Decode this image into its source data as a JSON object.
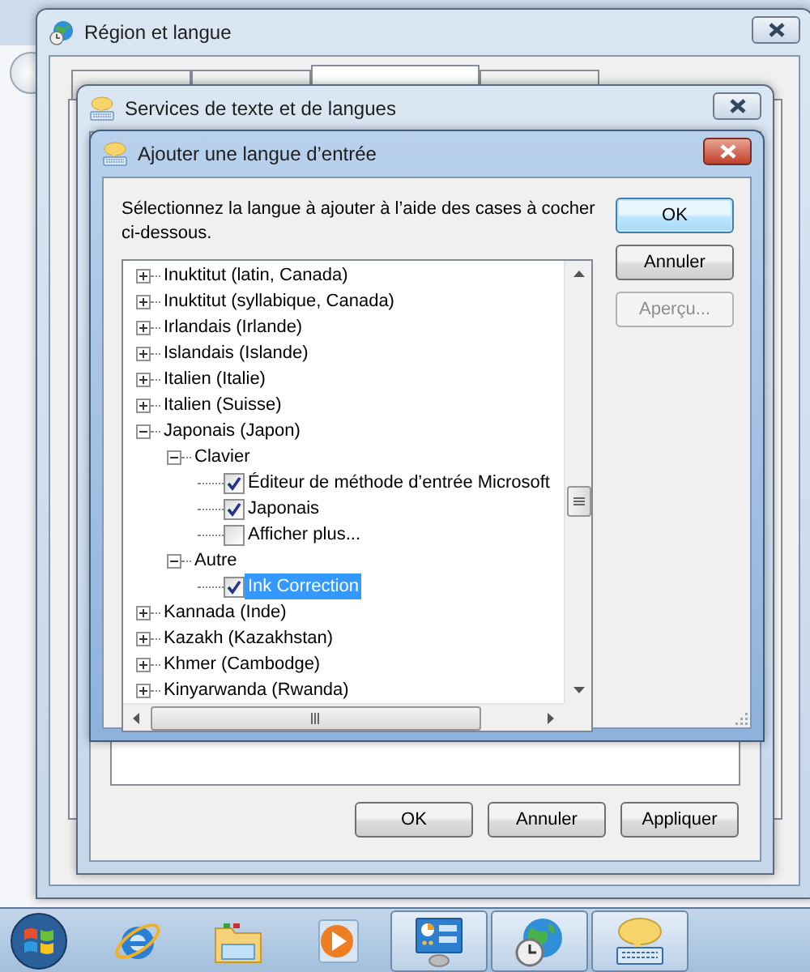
{
  "windows": {
    "region": {
      "title": "Région et langue",
      "tabs": [
        {
          "selected": false
        },
        {
          "selected": false
        },
        {
          "selected": true
        },
        {
          "selected": false
        }
      ]
    },
    "services": {
      "title": "Services de texte et de langues",
      "buttons": [
        {
          "label": "OK",
          "disabled": false
        },
        {
          "label": "Annuler",
          "disabled": false
        },
        {
          "label": "Appliquer",
          "disabled": false
        }
      ]
    },
    "add_language": {
      "title": "Ajouter une langue d’entrée",
      "instruction": "Sélectionnez la langue à ajouter à l’aide des cases à cocher ci-dessous.",
      "buttons": [
        {
          "label": "OK",
          "default": true,
          "disabled": false
        },
        {
          "label": "Annuler",
          "default": false,
          "disabled": false
        },
        {
          "label": "Aperçu...",
          "default": false,
          "disabled": true
        }
      ],
      "tree": [
        {
          "kind": "group",
          "label": "Inuktitut (latin, Canada)",
          "expanded": false,
          "selected": false
        },
        {
          "kind": "group",
          "label": "Inuktitut (syllabique, Canada)",
          "expanded": false,
          "selected": false
        },
        {
          "kind": "group",
          "label": "Irlandais (Irlande)",
          "expanded": false,
          "selected": false
        },
        {
          "kind": "group",
          "label": "Islandais (Islande)",
          "expanded": false,
          "selected": false
        },
        {
          "kind": "group",
          "label": "Italien (Italie)",
          "expanded": false,
          "selected": false
        },
        {
          "kind": "group",
          "label": "Italien (Suisse)",
          "expanded": false,
          "selected": false
        },
        {
          "kind": "group",
          "label": "Japonais (Japon)",
          "expanded": true,
          "selected": false,
          "children": [
            {
              "kind": "group",
              "label": "Clavier",
              "expanded": true,
              "selected": false,
              "children": [
                {
                  "kind": "option",
                  "label": "Éditeur de méthode d’entrée Microsoft",
                  "checked": true,
                  "selected": false
                },
                {
                  "kind": "option",
                  "label": "Japonais",
                  "checked": true,
                  "selected": false
                },
                {
                  "kind": "option",
                  "label": "Afficher plus...",
                  "checked": false,
                  "selected": false
                }
              ]
            },
            {
              "kind": "group",
              "label": "Autre",
              "expanded": true,
              "selected": false,
              "children": [
                {
                  "kind": "option",
                  "label": "Ink Correction",
                  "checked": true,
                  "selected": true
                }
              ]
            }
          ]
        },
        {
          "kind": "group",
          "label": "Kannada (Inde)",
          "expanded": false,
          "selected": false
        },
        {
          "kind": "group",
          "label": "Kazakh (Kazakhstan)",
          "expanded": false,
          "selected": false
        },
        {
          "kind": "group",
          "label": "Khmer (Cambodge)",
          "expanded": false,
          "selected": false
        },
        {
          "kind": "group",
          "label": "Kinyarwanda (Rwanda)",
          "expanded": false,
          "selected": false
        }
      ]
    }
  },
  "taskbar": {
    "items": [
      {
        "kind": "browser",
        "open": false
      },
      {
        "kind": "folder",
        "open": false
      },
      {
        "kind": "media",
        "open": false
      },
      {
        "kind": "control_panel",
        "open": true
      },
      {
        "kind": "region",
        "open": true
      },
      {
        "kind": "text_services",
        "open": true
      }
    ]
  }
}
